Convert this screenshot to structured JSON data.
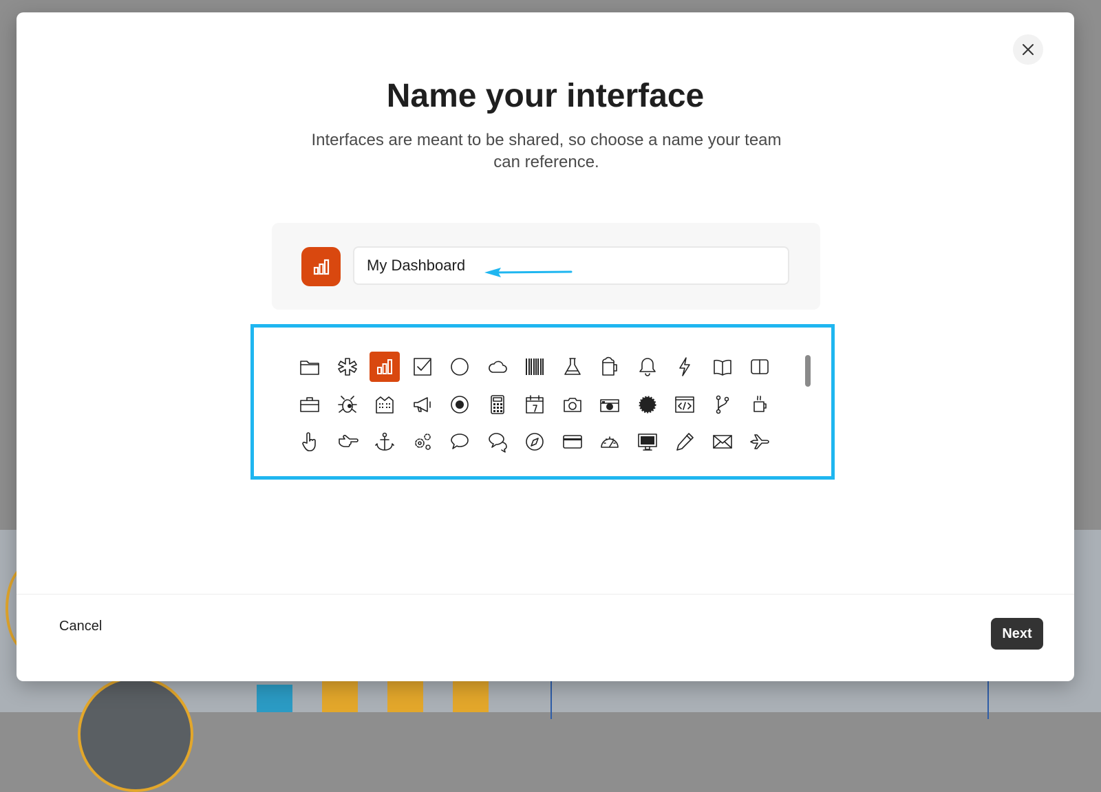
{
  "modal": {
    "title": "Name your interface",
    "subtitle": "Interfaces are meant to be shared, so choose a name your team can reference.",
    "name_input": {
      "value": "My Dashboard"
    },
    "selected_icon": "bar-chart-icon",
    "icon_picker": {
      "icons": [
        "folder-icon",
        "asterisk-icon",
        "bar-chart-icon",
        "checkbox-icon",
        "circle-icon",
        "cloud-icon",
        "barcode-icon",
        "flask-icon",
        "beer-mug-icon",
        "bell-icon",
        "lightning-icon",
        "open-book-icon",
        "book-icon",
        "briefcase-icon",
        "bug-icon",
        "buildings-icon",
        "megaphone-icon",
        "target-icon",
        "calculator-icon",
        "calendar-icon",
        "camera-icon",
        "camera-retro-icon",
        "gear-badge-icon",
        "code-window-icon",
        "git-branch-icon",
        "coffee-cup-icon",
        "hand-pointer-icon",
        "hand-point-right-icon",
        "anchor-icon",
        "gears-icon",
        "speech-bubble-icon",
        "speech-bubbles-icon",
        "compass-icon",
        "credit-card-icon",
        "dashboard-gauge-icon",
        "desktop-icon",
        "pencil-icon",
        "envelope-icon",
        "airplane-icon",
        "partial-icon",
        "partial-icon",
        "partial-icon",
        "partial-icon",
        "partial-icon",
        "partial-icon",
        "partial-icon",
        "partial-icon",
        "partial-icon",
        "partial-icon",
        "partial-icon",
        "partial-icon",
        "partial-icon"
      ]
    },
    "footer": {
      "cancel_label": "Cancel",
      "next_label": "Next"
    }
  },
  "colors": {
    "accent": "#d9480f",
    "highlight": "#1fb6f0",
    "primary_button": "#333333"
  },
  "annotation": {
    "arrow_color": "#1fb6f0"
  }
}
